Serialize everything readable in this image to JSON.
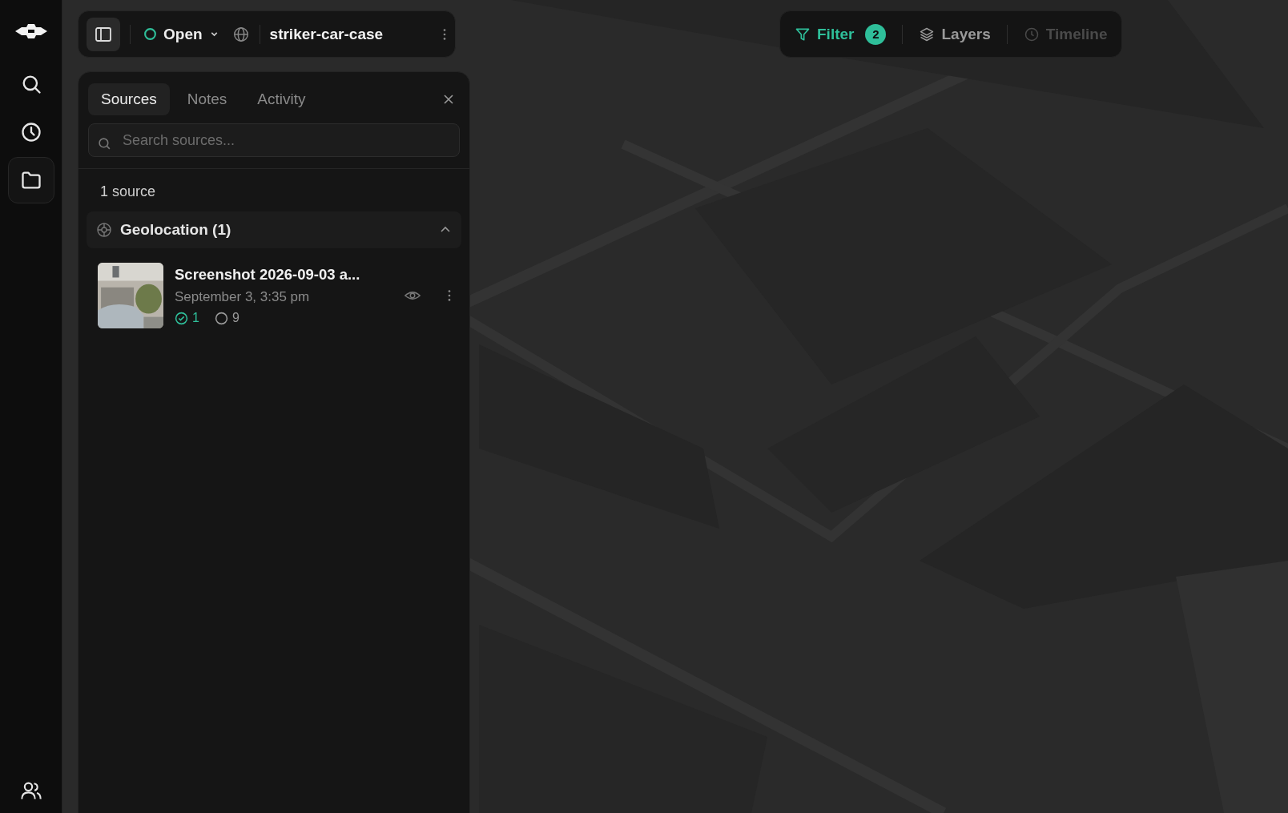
{
  "rail": {
    "items": [
      {
        "kind": "search",
        "selected": false
      },
      {
        "kind": "history",
        "selected": false
      },
      {
        "kind": "folder",
        "selected": true
      }
    ]
  },
  "toolbar": {
    "sidebar_open": true,
    "status": "Open",
    "project": "striker-car-case"
  },
  "map_controls": [
    {
      "kind": "filter",
      "label": "Filter",
      "badge": "2",
      "active": true,
      "disabled": false
    },
    {
      "kind": "layers",
      "label": "Layers",
      "active": false,
      "disabled": false
    },
    {
      "kind": "timeline",
      "label": "Timeline",
      "active": false,
      "disabled": true
    }
  ],
  "panel": {
    "tabs": [
      {
        "label": "Sources",
        "selected": true
      },
      {
        "label": "Notes",
        "selected": false
      },
      {
        "label": "Activity",
        "selected": false
      }
    ],
    "search": {
      "placeholder": "Search sources..."
    },
    "count": "1 source",
    "group": {
      "title": "Geolocation (1)",
      "expanded": true,
      "items": [
        {
          "title": "Screenshot 2026-09-03 a...",
          "date": "September 3, 3:35 pm",
          "confirmed": "1",
          "pending": "9"
        }
      ]
    }
  }
}
